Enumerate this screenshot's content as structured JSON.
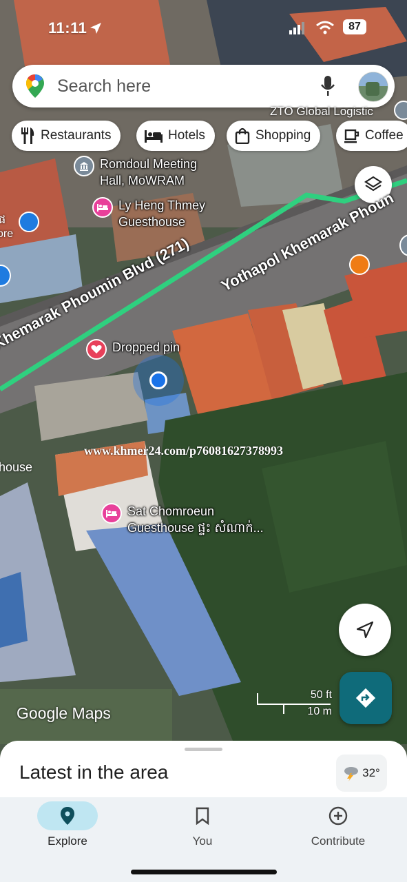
{
  "status_bar": {
    "time": "11:11",
    "battery": "87"
  },
  "search": {
    "placeholder": "Search here"
  },
  "chips": [
    {
      "label": "Restaurants",
      "icon": "fork-knife-icon"
    },
    {
      "label": "Hotels",
      "icon": "bed-icon"
    },
    {
      "label": "Shopping",
      "icon": "shopping-bag-icon"
    },
    {
      "label": "Coffee",
      "icon": "coffee-cup-icon"
    }
  ],
  "map": {
    "top_partial_label": "ZTO Global Logistic",
    "pois": [
      {
        "name": "Romdoul Meeting\nHall, MoWRAM",
        "icon": "building-icon",
        "color": "#7a8a99"
      },
      {
        "name": "Ly Heng Thmey\nGuesthouse",
        "icon": "bed-icon",
        "color": "#e8409a"
      },
      {
        "name": "Dropped pin",
        "icon": "heart-icon",
        "color": "#e8405a"
      },
      {
        "name": "Sat Chomroeun\nGuesthouse ផ្ទះ សំណាក់...",
        "icon": "bed-icon",
        "color": "#e8409a"
      }
    ],
    "left_partial_labels": [
      "ផ",
      "ore",
      "house"
    ],
    "road_labels": [
      "Khemarak Phoumin Blvd (271)",
      "Yothapol Khemarak Phoun"
    ],
    "watermark": "www.khmer24.com/p76081627378993",
    "google_logo": "Google Maps",
    "scale": {
      "imperial": "50 ft",
      "metric": "10 m"
    }
  },
  "sheet": {
    "title": "Latest in the area",
    "temperature": "32°",
    "weather_icon": "thunderstorm-icon"
  },
  "nav": [
    {
      "label": "Explore",
      "icon": "location-pin-icon",
      "active": true
    },
    {
      "label": "You",
      "icon": "bookmark-icon",
      "active": false
    },
    {
      "label": "Contribute",
      "icon": "plus-circle-icon",
      "active": false
    }
  ],
  "colors": {
    "road": "#2fd07f",
    "accent": "#0f6b7a",
    "location_dot": "#1a73e8"
  }
}
